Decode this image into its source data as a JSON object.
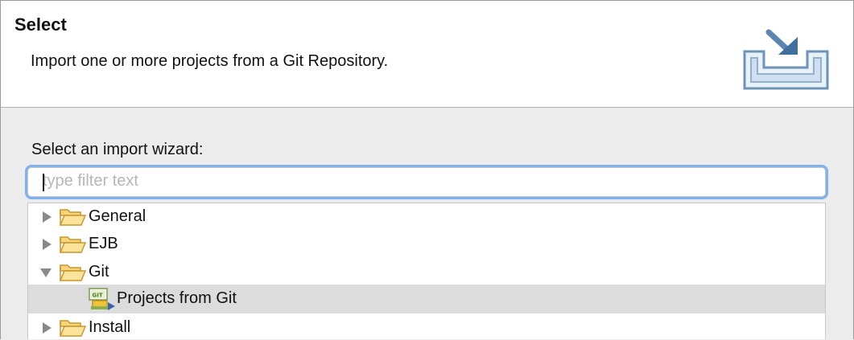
{
  "header": {
    "title": "Select",
    "description": "Import one or more projects from a Git Repository.",
    "icon": "import-wizard-banner-icon"
  },
  "wizard": {
    "label": "Select an import wizard:",
    "filter_placeholder": "type filter text",
    "filter_value": ""
  },
  "tree": {
    "items": [
      {
        "label": "General",
        "icon": "folder-icon",
        "expanded": false,
        "selected": false
      },
      {
        "label": "EJB",
        "icon": "folder-icon",
        "expanded": false,
        "selected": false
      },
      {
        "label": "Git",
        "icon": "folder-icon",
        "expanded": true,
        "selected": false
      },
      {
        "label": "Projects from Git",
        "icon": "git-projects-icon",
        "child": true,
        "selected": true
      },
      {
        "label": "Install",
        "icon": "folder-icon",
        "expanded": false,
        "selected": false
      }
    ]
  },
  "colors": {
    "accent_focus": "#7fb2ef",
    "selection_bg": "#dcdcdc",
    "folder_fill": "#f6d57a",
    "folder_stroke": "#c8962a"
  }
}
